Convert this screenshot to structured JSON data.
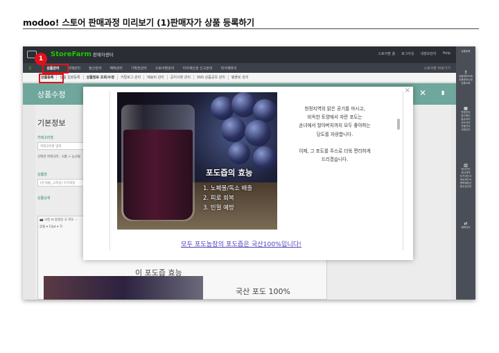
{
  "doc_title": "modoo! 스토어 판매과정 미리보기 (1)판매자가 상품 등록하기",
  "app": {
    "brand": "StoreFarm",
    "brand_sub": "판매자센터",
    "top_links": [
      "스토어팜 홈",
      "로그아웃",
      "내정보관리",
      "Help"
    ],
    "step_number": "1"
  },
  "menu": {
    "home": "홈",
    "items": [
      "상품관리",
      "판매관리",
      "정산관리",
      "혜택관리",
      "기획전관리",
      "스토어팜관리",
      "지식재산권 신고관리",
      "직거래마이"
    ],
    "right_label": "스토어팜 바로가기"
  },
  "submenu": {
    "items": [
      "상품등록",
      "상품 일괄등록",
      "상품정보 조회/수정",
      "카탈로그 관리",
      "배송비 관리",
      "공지사항 관리",
      "SNS 상품공유 관리",
      "템플릿 관리"
    ]
  },
  "sidebar": {
    "groups": [
      {
        "icon": "▤",
        "lines": [
          "상품등록"
        ]
      },
      {
        "icon": "↥",
        "lines": [
          "상품정보조회",
          "상품정보수정",
          "상품조회"
        ]
      },
      {
        "icon": "▦",
        "lines": [
          "판매관리",
          "발주확인",
          "발송처리",
          "취소관리",
          "반품관리",
          "교환관리"
        ]
      },
      {
        "icon": "▥",
        "lines": [
          "정산관리",
          "정산내역",
          "부가세신고",
          "세금계산서",
          "항목별정산",
          "충전금관리"
        ]
      },
      {
        "icon": "⇄",
        "lines": [
          "혜택관리"
        ]
      }
    ]
  },
  "page": {
    "title": "상품수정",
    "section_title": "기본정보",
    "category_label": "카테고리명",
    "category_placeholder": "카테고리명 입력",
    "category_selected": "선택한 카테고리 : 식품 > 농산물",
    "product_name_label": "상품명",
    "product_name_value": "[운석물(_고독응) 우리과일",
    "detail_label": "상품상세",
    "editor_toolbar_1": "📷 사진  ⊡ 동영상  ☰ 지도  ⋯",
    "editor_toolbar_2": "글꼴  ▾  12pt  ▾  가",
    "editor_behind_text": "이 포도즙 효능",
    "editor_bottom_text": "국산 포도 100%"
  },
  "modal": {
    "close_icon": "×",
    "caption_title": "포도즙의 효능",
    "caption_items": [
      "1. 노폐물/독소 배출",
      "2. 피로 회복",
      "3. 빈혈 예방"
    ],
    "story_1": [
      "청정지역의 맑은 공기를 마시고,",
      "비옥한 토양에서 자란 포도는",
      "손녀에서 할아버지까지 모두 좋아하는",
      "당도를 자랑합니다."
    ],
    "story_2": [
      "이제, 그 포도를 주스로 더욱 편리하게",
      "드리겠습니다."
    ],
    "link_text": "모두 포도농장의 포도즙은 국산100%입니다!"
  },
  "colors": {
    "brand_green": "#1ec800",
    "highlight_red": "#e0111a",
    "teal_header": "#6fa79c",
    "link_blue": "#4a3fb8"
  }
}
